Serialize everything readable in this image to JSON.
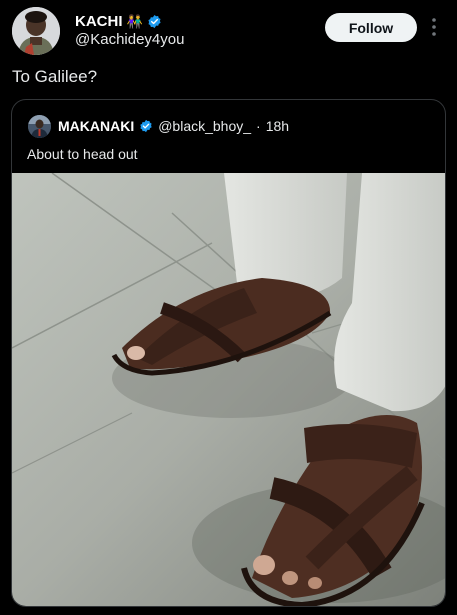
{
  "author": {
    "display_name": "KACHI",
    "name_emoji": "👫",
    "handle": "@Kachidey4you",
    "verified": true
  },
  "actions": {
    "follow_label": "Follow",
    "more_icon": "more-vertical-icon"
  },
  "tweet": {
    "text": "To Galilee?"
  },
  "quote": {
    "display_name": "MAKANAKI",
    "handle": "@black_bhoy_",
    "separator": "·",
    "time": "18h",
    "text": "About to head out",
    "media": "photo-feet-in-leather-sandals"
  },
  "colors": {
    "background": "#000000",
    "text": "#e7e9ea",
    "verified": "#1d9bf0",
    "border": "#333639",
    "follow_bg": "#eff3f4"
  }
}
